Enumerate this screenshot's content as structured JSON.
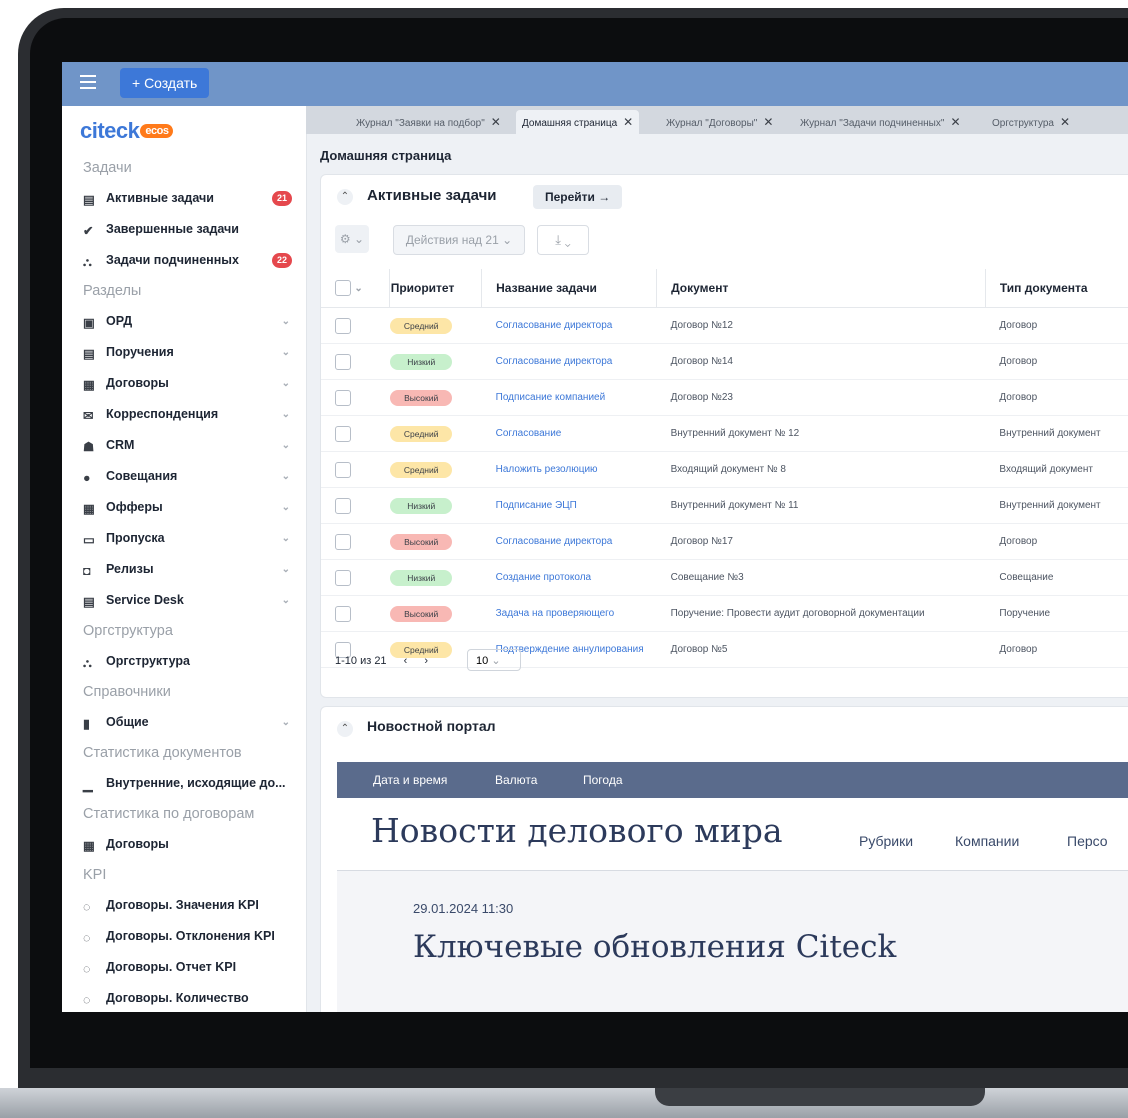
{
  "topbar": {
    "create_label": "+ Создать"
  },
  "logo": {
    "brand": "citeck",
    "badge": "ecos"
  },
  "sidebar": {
    "items": [
      {
        "type": "section",
        "label": "Задачи"
      },
      {
        "type": "item",
        "label": "Активные задачи",
        "icon": "clipboard-icon",
        "badge": "21"
      },
      {
        "type": "item",
        "label": "Завершенные задачи",
        "icon": "check-circle-icon"
      },
      {
        "type": "item",
        "label": "Задачи подчиненных",
        "icon": "org-tree-icon",
        "badge": "22"
      },
      {
        "type": "section",
        "label": "Разделы"
      },
      {
        "type": "item",
        "label": "ОРД",
        "icon": "ord-icon",
        "chevron": true
      },
      {
        "type": "item",
        "label": "Поручения",
        "icon": "clipboard-icon",
        "chevron": true
      },
      {
        "type": "item",
        "label": "Договоры",
        "icon": "contract-icon",
        "chevron": true
      },
      {
        "type": "item",
        "label": "Корреспонденция",
        "icon": "envelope-icon",
        "chevron": true
      },
      {
        "type": "item",
        "label": "CRM",
        "icon": "people-icon",
        "chevron": true
      },
      {
        "type": "item",
        "label": "Совещания",
        "icon": "chat-icon",
        "chevron": true
      },
      {
        "type": "item",
        "label": "Офферы",
        "icon": "contract-icon",
        "chevron": true
      },
      {
        "type": "item",
        "label": "Пропуска",
        "icon": "pass-icon",
        "chevron": true
      },
      {
        "type": "item",
        "label": "Релизы",
        "icon": "release-icon",
        "chevron": true
      },
      {
        "type": "item",
        "label": "Service Desk",
        "icon": "clipboard-icon",
        "chevron": true
      },
      {
        "type": "section",
        "label": "Оргструктура"
      },
      {
        "type": "item",
        "label": "Оргструктура",
        "icon": "org-tree-icon"
      },
      {
        "type": "section",
        "label": "Справочники"
      },
      {
        "type": "item",
        "label": "Общие",
        "icon": "book-icon",
        "chevron": true
      },
      {
        "type": "section",
        "label": "Статистика документов"
      },
      {
        "type": "item",
        "label": "Внутренние, исходящие до...",
        "icon": "bar-chart-icon"
      },
      {
        "type": "section",
        "label": "Статистика по договорам"
      },
      {
        "type": "item",
        "label": "Договоры",
        "icon": "contract-icon"
      },
      {
        "type": "section",
        "label": "KPI"
      },
      {
        "type": "item",
        "label": "Договоры. Значения KPI",
        "icon": "dashed-circle-icon"
      },
      {
        "type": "item",
        "label": "Договоры. Отклонения KPI",
        "icon": "dashed-circle-icon"
      },
      {
        "type": "item",
        "label": "Договоры. Отчет KPI",
        "icon": "dashed-circle-icon"
      },
      {
        "type": "item",
        "label": "Договоры. Количество",
        "icon": "dashed-circle-icon"
      }
    ]
  },
  "tabs": [
    {
      "label": "Журнал \"Заявки на подбор\"",
      "active": false
    },
    {
      "label": "Домашняя страница",
      "active": true
    },
    {
      "label": "Журнал \"Договоры\"",
      "active": false
    },
    {
      "label": "Журнал \"Задачи подчиненных\"",
      "active": false
    },
    {
      "label": "Оргструктура",
      "active": false
    }
  ],
  "page": {
    "title": "Домашняя страница"
  },
  "tasks_panel": {
    "title": "Активные задачи",
    "goto_label": "Перейти →",
    "actions_label": "Действия над 21",
    "columns": [
      "Приоритет",
      "Название задачи",
      "Документ",
      "Тип документа"
    ],
    "rows": [
      {
        "priority": "Средний",
        "level": "mid",
        "task": "Согласование директора",
        "document": "Договор №12",
        "doc_type": "Договор"
      },
      {
        "priority": "Низкий",
        "level": "low",
        "task": "Согласование директора",
        "document": "Договор №14",
        "doc_type": "Договор"
      },
      {
        "priority": "Высокий",
        "level": "high",
        "task": "Подписание компанией",
        "document": "Договор №23",
        "doc_type": "Договор"
      },
      {
        "priority": "Средний",
        "level": "mid",
        "task": "Согласование",
        "document": "Внутренний документ № 12",
        "doc_type": "Внутренний документ"
      },
      {
        "priority": "Средний",
        "level": "mid",
        "task": "Наложить резолюцию",
        "document": "Входящий документ № 8",
        "doc_type": "Входящий документ"
      },
      {
        "priority": "Низкий",
        "level": "low",
        "task": "Подписание ЭЦП",
        "document": "Внутренний документ № 11",
        "doc_type": "Внутренний документ"
      },
      {
        "priority": "Высокий",
        "level": "high",
        "task": "Согласование директора",
        "document": "Договор №17",
        "doc_type": "Договор"
      },
      {
        "priority": "Низкий",
        "level": "low",
        "task": "Создание протокола",
        "document": "Совещание №3",
        "doc_type": "Совещание"
      },
      {
        "priority": "Высокий",
        "level": "high",
        "task": "Задача на проверяющего",
        "document": "Поручение: Провести аудит договорной документации",
        "doc_type": "Поручение"
      },
      {
        "priority": "Средний",
        "level": "mid",
        "task": "Подтверждение аннулирования",
        "document": "Договор №5",
        "doc_type": "Договор"
      }
    ],
    "pager_text": "1-10 из 21",
    "page_size": "10"
  },
  "news_panel": {
    "title": "Новостной портал",
    "nav": [
      "Дата и время",
      "Валюта",
      "Погода"
    ],
    "brand": "Новости делового мира",
    "menu": [
      "Рубрики",
      "Компании",
      "Персо"
    ],
    "date": "29.01.2024 11:30",
    "headline": "Ключевые обновления Citeck"
  },
  "colors": {
    "topbar": "#7095c8",
    "accent": "#3d78d8",
    "badge": "#e5484d",
    "priority_mid": "#fde6a7",
    "priority_low": "#c7f0cc",
    "priority_high": "#f8b8b4"
  }
}
